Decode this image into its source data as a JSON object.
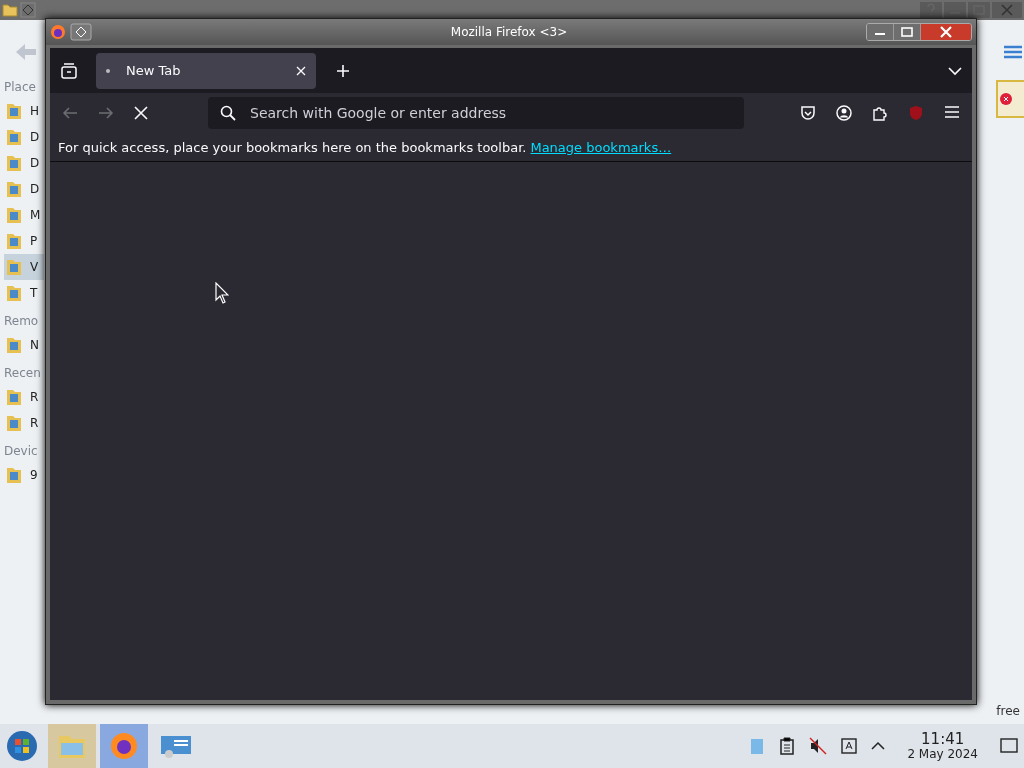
{
  "background_window": {
    "sidebar": [
      {
        "heading": "Place",
        "items": [
          {
            "label": "H",
            "selected": false
          },
          {
            "label": "D",
            "selected": false
          },
          {
            "label": "D",
            "selected": false
          },
          {
            "label": "D",
            "selected": false
          },
          {
            "label": "M",
            "selected": false
          },
          {
            "label": "P",
            "selected": false
          },
          {
            "label": "V",
            "selected": true
          },
          {
            "label": "T",
            "selected": false
          }
        ]
      },
      {
        "heading": "Remo",
        "items": [
          {
            "label": "N",
            "selected": false
          }
        ]
      },
      {
        "heading": "Recen",
        "items": [
          {
            "label": "R",
            "selected": false
          },
          {
            "label": "R",
            "selected": false
          }
        ]
      },
      {
        "heading": "Devic",
        "items": [
          {
            "label": "9",
            "selected": false
          }
        ]
      }
    ],
    "status_text": "free"
  },
  "window": {
    "title": "Mozilla Firefox <3>"
  },
  "tabs": [
    {
      "label": "New Tab",
      "selected": true
    }
  ],
  "address_bar": {
    "placeholder": "Search with Google or enter address"
  },
  "bookmarks_bar": {
    "message": "For quick access, place your bookmarks here on the bookmarks toolbar.",
    "link": "Manage bookmarks…"
  },
  "taskbar": {
    "apps": [
      {
        "kind": "folder",
        "selected": false
      },
      {
        "kind": "firefox",
        "selected": true
      },
      {
        "kind": "remote",
        "selected": false
      }
    ],
    "clock": {
      "time": "11:41",
      "date": "2 May 2024"
    }
  }
}
